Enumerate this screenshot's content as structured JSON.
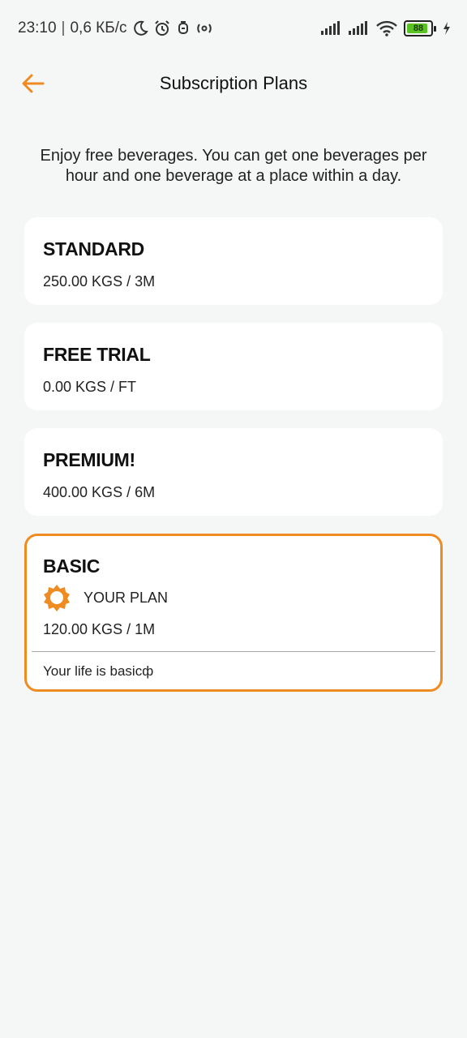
{
  "status_bar": {
    "time": "23:10",
    "separator": "|",
    "network_speed": "0,6 КБ/с",
    "battery_level": "88",
    "battery_fraction": 0.88,
    "icons": [
      "moon-icon",
      "alarm-icon",
      "notification-icon",
      "hotspot-icon",
      "signal-icon",
      "signal-icon",
      "wifi-icon",
      "battery-icon",
      "charging-icon"
    ]
  },
  "header": {
    "title": "Subscription Plans",
    "back_icon": "arrow-left-icon"
  },
  "description": "Enjoy free beverages. You can get one beverages per hour and one beverage at a place within a day.",
  "plans": [
    {
      "name": "STANDARD",
      "price": "250.00 KGS / 3M"
    },
    {
      "name": "FREE TRIAL",
      "price": "0.00 KGS / FT"
    },
    {
      "name": "PREMIUM!",
      "price": "400.00 KGS / 6M"
    }
  ],
  "current_plan": {
    "name": "BASIC",
    "badge_icon": "sun-badge-icon",
    "badge_label": "YOUR PLAN",
    "price": "120.00 KGS / 1M",
    "description": "Your life is basicф"
  },
  "colors": {
    "accent": "#ee8b22",
    "background": "#f5f7f6",
    "card": "#ffffff",
    "battery": "#58c322"
  }
}
